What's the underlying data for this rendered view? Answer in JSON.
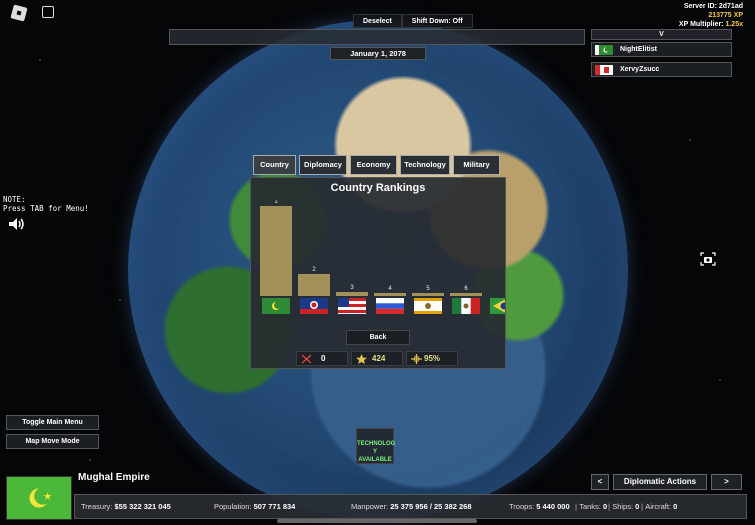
{
  "server": {
    "id_label": "Server ID: 2d71ad",
    "xp": "213775 XP",
    "multiplier_label": "XP Multiplier:",
    "multiplier_value": "1.25x"
  },
  "top": {
    "deselect": "Deselect",
    "shift_down": "Shift Down: Off",
    "date": "January 1, 2078"
  },
  "players": {
    "header": "V",
    "list": [
      {
        "name": "NightElitist"
      },
      {
        "name": "XervyZsucc"
      }
    ]
  },
  "note": {
    "line1": "NOTE:",
    "line2": "Press TAB for Menu!"
  },
  "tabs": [
    {
      "label": "Country"
    },
    {
      "label": "Diplomacy"
    },
    {
      "label": "Economy"
    },
    {
      "label": "Technology"
    },
    {
      "label": "Military"
    }
  ],
  "panel": {
    "title": "Country Rankings",
    "back": "Back"
  },
  "chart_data": {
    "type": "bar",
    "categories": [
      "1",
      "2",
      "3",
      "4",
      "5",
      "6"
    ],
    "values": [
      89,
      22,
      4,
      3,
      1,
      1
    ]
  },
  "stats": {
    "war": "0",
    "stars": "424",
    "stability": "95%"
  },
  "left_buttons": {
    "toggle_main_menu": "Toggle Main Menu",
    "map_move_mode": "Map Move Mode"
  },
  "tech": {
    "line1": "TECHNOLOG",
    "line2": "Y AVAILABLE"
  },
  "empire": {
    "name": "Mughal Empire"
  },
  "nav": {
    "prev": "<",
    "diplomatic_actions": "Diplomatic Actions",
    "next": ">"
  },
  "bottom": {
    "treasury_label": "Treasury:",
    "treasury": "$55 322 321 045",
    "population_label": "Population:",
    "population": "507 771 834",
    "manpower_label": "Manpower:",
    "manpower": "25 375 956  /  25 382 268",
    "troops_label": "Troops:",
    "troops": "5 440 000",
    "tanks_label": "Tanks:",
    "tanks": "0",
    "ships_label": "Ships:",
    "ships": "0",
    "aircraft_label": "Aircraft:",
    "aircraft": "0"
  },
  "colors": {
    "bar": "#a39159",
    "tech_text": "#7cf07c",
    "xp": "#f3c84b",
    "empire_flag": "#4cb83a"
  }
}
